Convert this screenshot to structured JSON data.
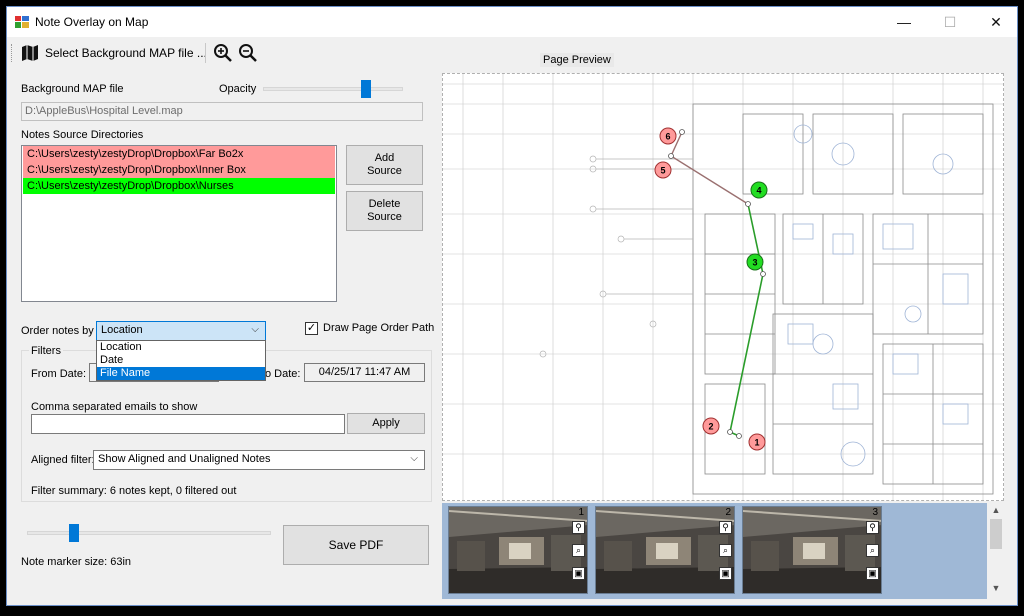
{
  "window": {
    "title": "Note Overlay on Map",
    "minimize": "—",
    "maximize": "☐",
    "close": "✕"
  },
  "toolbar": {
    "select_map_label": "Select Background MAP file ...",
    "map_icon": "map-icon",
    "zoom_in_icon": "zoom-in-icon",
    "zoom_out_icon": "zoom-out-icon"
  },
  "map_file": {
    "label": "Background MAP file",
    "path": "D:\\AppleBus\\Hospital Level.map"
  },
  "opacity": {
    "label": "Opacity",
    "value": 0.75
  },
  "sources": {
    "label": "Notes Source Directories",
    "items": [
      {
        "path": "C:\\Users\\zesty\\zestyDrop\\Dropbox\\Far Bo2x",
        "color": "#ff9a9a"
      },
      {
        "path": "C:\\Users\\zesty\\zestyDrop\\Dropbox\\Inner Box",
        "color": "#ff9a9a"
      },
      {
        "path": "C:\\Users\\zesty\\zestyDrop\\Dropbox\\Nurses",
        "color": "#00ff00"
      }
    ],
    "add_label": "Add Source",
    "delete_label": "Delete Source"
  },
  "order": {
    "label": "Order notes by",
    "selected": "Location",
    "options": [
      "Location",
      "Date",
      "File Name"
    ],
    "highlighted": "File Name",
    "draw_path_label": "Draw Page Order Path",
    "draw_path_checked": "✓"
  },
  "filters": {
    "group_label": "Filters",
    "from_date_label": "From Date:",
    "to_date_label": "o Date:",
    "to_date": "04/25/17 11:47 AM",
    "emails_label": "Comma separated emails to show",
    "emails_value": "",
    "apply_label": "Apply",
    "aligned_label": "Aligned filter:",
    "aligned_value": "Show Aligned and Unaligned Notes",
    "summary": "Filter summary: 6 notes kept, 0 filtered out"
  },
  "marker": {
    "value": 0.18,
    "label": "Note marker size: 63in"
  },
  "save_pdf_label": "Save PDF",
  "preview": {
    "title": "Page Preview",
    "markers": [
      {
        "num": "1",
        "color": "#ff9a9a"
      },
      {
        "num": "2",
        "color": "#ff9a9a"
      },
      {
        "num": "3",
        "color": "#22dd22"
      },
      {
        "num": "4",
        "color": "#22dd22"
      },
      {
        "num": "5",
        "color": "#ff9a9a"
      },
      {
        "num": "6",
        "color": "#ff9a9a"
      }
    ],
    "path_colors": {
      "green": "#2a9d2a",
      "brown": "#9a7070"
    }
  },
  "thumbnails": [
    {
      "num": "1"
    },
    {
      "num": "2"
    },
    {
      "num": "3"
    }
  ],
  "thumb_icons": [
    "location-pin-icon",
    "magnify-icon",
    "camera-icon"
  ],
  "scroll_up": "▲",
  "scroll_down": "▼"
}
